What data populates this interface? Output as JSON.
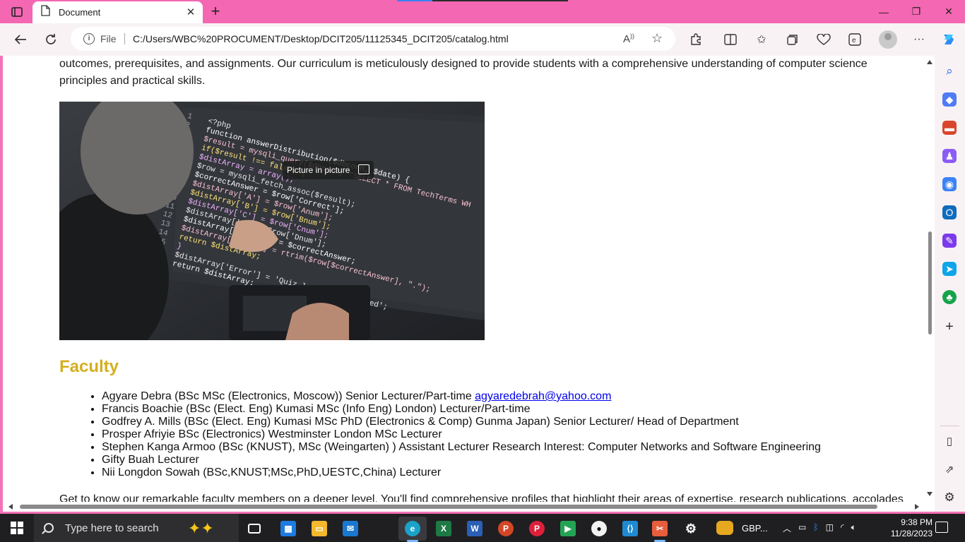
{
  "browser": {
    "tab_title": "Document",
    "close_tab_glyph": "✕",
    "new_tab_glyph": "+",
    "address": {
      "file_label": "File",
      "url": "C:/Users/WBC%20PROCUMENT/Desktop/DCIT205/11125345_DCIT205/catalog.html"
    },
    "window_controls": {
      "minimize": "—",
      "restore": "❐",
      "close": "✕"
    }
  },
  "page": {
    "intro_text": "outcomes, prerequisites, and assignments. Our curriculum is meticulously designed to provide students with a comprehensive understanding of computer science principles and practical skills.",
    "pip_label": "Picture in picture",
    "faculty_heading": "Faculty",
    "faculty": [
      {
        "text": "Agyare Debra (BSc MSc (Electronics, Moscow)) Senior Lecturer/Part-time ",
        "email": "agyaredebrah@yahoo.com"
      },
      {
        "text": "Francis Boachie (BSc (Elect. Eng) Kumasi MSc (Info Eng) London) Lecturer/Part-time"
      },
      {
        "text": "Godfrey A. Mills (BSc (Elect. Eng) Kumasi MSc PhD (Electronics & Comp) Gunma Japan) Senior Lecturer/ Head of Department"
      },
      {
        "text": "Prosper Afriyie BSc (Electronics) Westminster London MSc Lecturer"
      },
      {
        "text": "Stephen Kanga Armoo (BSc (KNUST), MSc (Weingarten) ) Assistant Lecturer Research Interest: Computer Networks and Software Engineering"
      },
      {
        "text": "Gifty Buah Lecturer"
      },
      {
        "text": "Nii Longdon Sowah (BSc,KNUST;MSc,PhD,UESTC,China) Lecturer"
      }
    ],
    "outro_text": "Get to know our remarkable faculty members on a deeper level. You'll find comprehensive profiles that highlight their areas of expertise, research publications, accolades",
    "heading_color": "#d4af1f"
  },
  "code_image": {
    "lines": [
      "<?php",
      "function answerDistribution($dbconn, $date) {",
      "  $result = mysqli_query($dbconn, \"SELECT * FROM TechTerms WH",
      "  if($result !== false) {",
      "    $distArray = array();",
      "    $row = mysqli_fetch_assoc($result);",
      "    $correctAnswer = $row['Correct'];",
      "    $distArray['A'] = $row['Anum'];",
      "    $distArray['B'] = $row['Bnum'];",
      "    $distArray['C'] = $row['Cnum'];",
      "    $distArray['D'] = $row['Dnum'];",
      "    $distArray['Answer'] = $correctAnswer;",
      "    $distArray['Query'] = rtrim($row[$correctAnswer], \".\");",
      "    return $distArray;",
      "  }",
      "  $distArray['Error'] = 'Quiz load query failed';",
      "  return $distArray;"
    ]
  },
  "taskbar": {
    "search_placeholder": "Type here to search",
    "weather_text": "GBP...",
    "time": "9:38 PM",
    "date": "11/28/2023"
  },
  "colors": {
    "titlebar": "#f467b2",
    "toolbar": "#f8f2f5",
    "taskbar": "#1f1f22",
    "link": "#0000ee"
  }
}
